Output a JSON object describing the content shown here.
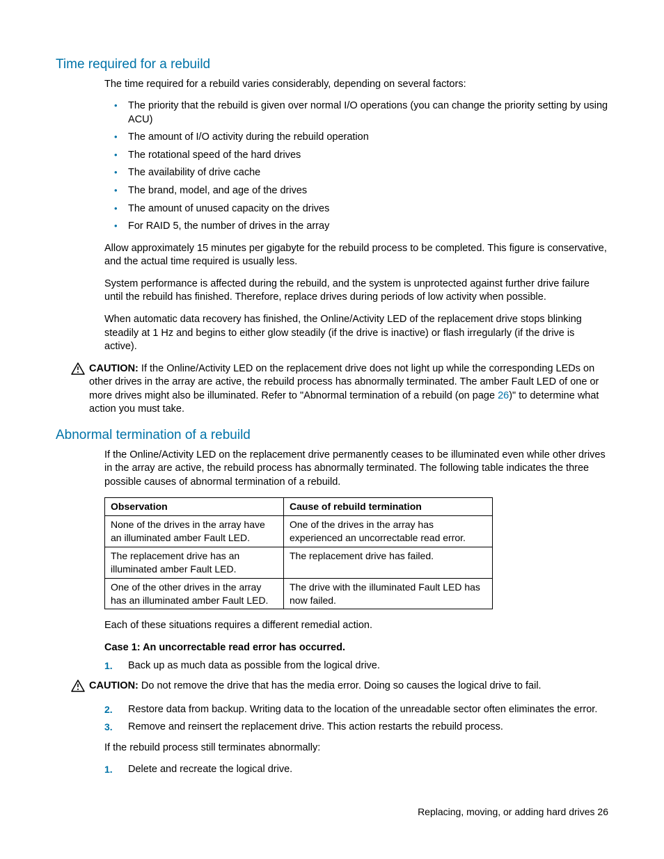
{
  "section1": {
    "heading": "Time required for a rebuild",
    "intro": "The time required for a rebuild varies considerably, depending on several factors:",
    "bullets": [
      "The priority that the rebuild is given over normal I/O operations (you can change the priority setting by using ACU)",
      "The amount of I/O activity during the rebuild operation",
      "The rotational speed of the hard drives",
      "The availability of drive cache",
      "The brand, model, and age of the drives",
      "The amount of unused capacity on the drives",
      "For RAID 5, the number of drives in the array"
    ],
    "p2": "Allow approximately 15 minutes per gigabyte for the rebuild process to be completed. This figure is conservative, and the actual time required is usually less.",
    "p3": "System performance is affected during the rebuild, and the system is unprotected against further drive failure until the rebuild has finished. Therefore, replace drives during periods of low activity when possible.",
    "p4": "When automatic data recovery has finished, the Online/Activity LED of the replacement drive stops blinking steadily at 1 Hz and begins to either glow steadily (if the drive is inactive) or flash irregularly (if the drive is active)."
  },
  "caution1": {
    "label": "CAUTION:",
    "before_link": "  If the Online/Activity LED on the replacement drive does not light up while the corresponding LEDs on other drives in the array are active, the rebuild process has abnormally terminated. The amber Fault LED of one or more drives might also be illuminated. Refer to \"Abnormal termination of a rebuild (on page ",
    "link": "26",
    "after_link": ")\" to determine what action you must take."
  },
  "section2": {
    "heading": "Abnormal termination of a rebuild",
    "intro": "If the Online/Activity LED on the replacement drive permanently ceases to be illuminated even while other drives in the array are active, the rebuild process has abnormally terminated. The following table indicates the three possible causes of abnormal termination of a rebuild.",
    "table": {
      "h1": "Observation",
      "h2": "Cause of rebuild termination",
      "rows": [
        {
          "obs": "None of the drives in the array have an illuminated amber Fault LED.",
          "cause": "One of the drives in the array has experienced an uncorrectable read error."
        },
        {
          "obs": "The replacement drive has an illuminated amber Fault LED.",
          "cause": "The replacement drive has failed."
        },
        {
          "obs": "One of the other drives in the array has an illuminated amber Fault LED.",
          "cause": "The drive with the illuminated Fault LED has now failed."
        }
      ]
    },
    "after_table": "Each of these situations requires a different remedial action.",
    "case1_head": "Case 1: An uncorrectable read error has occurred.",
    "steps_a": [
      "Back up as much data as possible from the logical drive."
    ],
    "caution2": {
      "label": "CAUTION:",
      "text": "  Do not remove the drive that has the media error. Doing so causes the logical drive to fail."
    },
    "steps_b": [
      "Restore data from backup. Writing data to the location of the unreadable sector often eliminates the error.",
      "Remove and reinsert the replacement drive. This action restarts the rebuild process."
    ],
    "after_steps": "If the rebuild process still terminates abnormally:",
    "steps_c": [
      "Delete and recreate the logical drive."
    ]
  },
  "footer": {
    "text": "Replacing, moving, or adding hard drives   26"
  }
}
